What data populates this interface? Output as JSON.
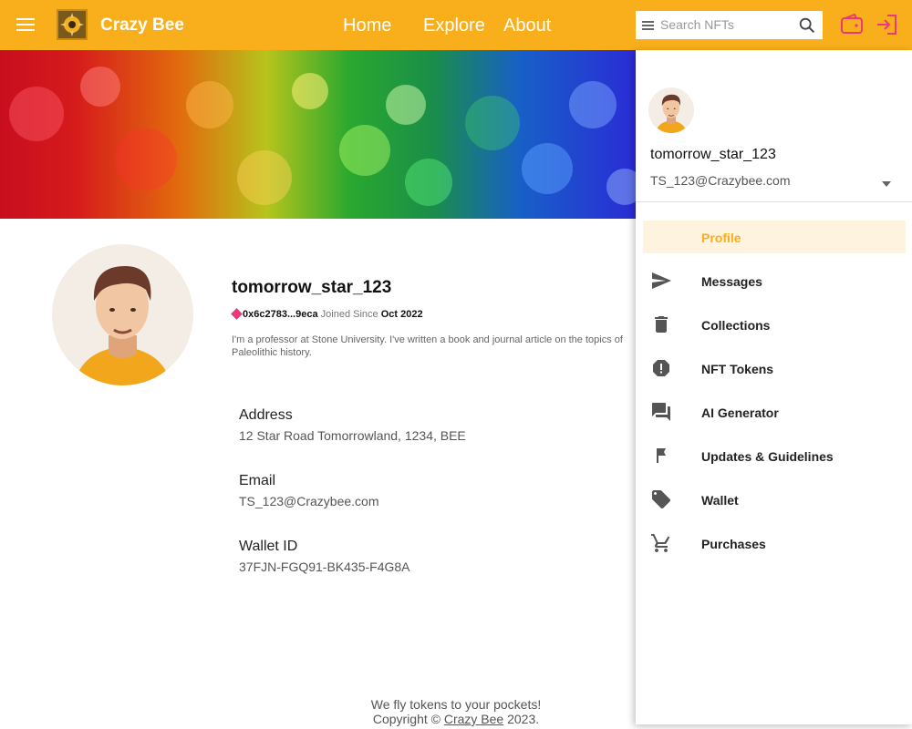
{
  "header": {
    "brand": "Crazy Bee",
    "nav": [
      "Home",
      "Explore",
      "About"
    ],
    "search_placeholder": "Search NFTs",
    "accent_color": "#f9ae1b",
    "icon_color": "#e9397a"
  },
  "profile": {
    "username": "tomorrow_star_123",
    "wallet_short": "0x6c2783...9eca",
    "joined_label": "Joined Since",
    "joined_date": "Oct 2022",
    "bio": "I'm a professor at Stone University. I've written a book and journal article on the topics of Paleolithic history.",
    "fields": [
      {
        "label": "Address",
        "value": "12 Star Road Tomorrowland, 1234, BEE"
      },
      {
        "label": "Email",
        "value": "TS_123@Crazybee.com"
      },
      {
        "label": "Wallet ID",
        "value": "37FJN-FGQ91-BK435-F4G8A"
      }
    ]
  },
  "footer": {
    "tagline": "We fly tokens to your pockets!",
    "copyright_prefix": "Copyright ©",
    "copyright_link": "Crazy Bee",
    "copyright_year": "2023."
  },
  "drawer": {
    "username": "tomorrow_star_123",
    "email": "TS_123@Crazybee.com",
    "items": [
      {
        "label": "Profile",
        "icon": "none",
        "active": true
      },
      {
        "label": "Messages",
        "icon": "send-icon"
      },
      {
        "label": "Collections",
        "icon": "trash-icon"
      },
      {
        "label": "NFT Tokens",
        "icon": "alert-icon"
      },
      {
        "label": "AI Generator",
        "icon": "chat-icon"
      },
      {
        "label": "Updates & Guidelines",
        "icon": "flag-icon"
      },
      {
        "label": "Wallet",
        "icon": "tag-icon"
      },
      {
        "label": "Purchases",
        "icon": "cart-icon"
      }
    ]
  }
}
